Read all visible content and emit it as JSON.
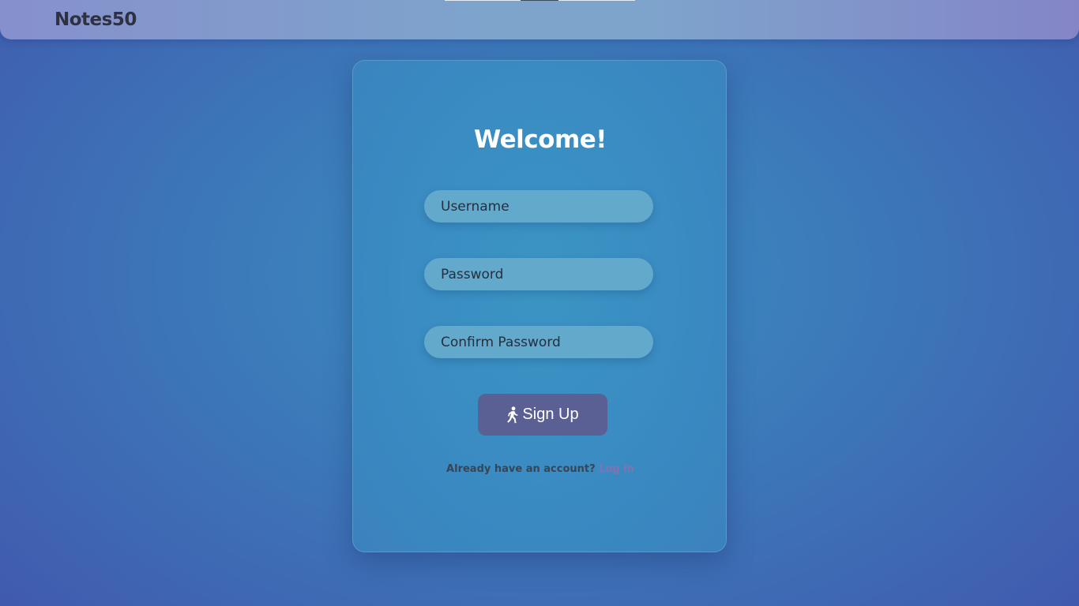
{
  "navbar": {
    "brand": "Notes50"
  },
  "form": {
    "title": "Welcome!",
    "username_placeholder": "Username",
    "password_placeholder": "Password",
    "confirm_password_placeholder": "Confirm Password",
    "submit_label": "Sign Up",
    "submit_icon": "walking-person-icon",
    "footer_text": "Already have an account?",
    "login_link_label": "Log in"
  },
  "colors": {
    "background_center": "#3a8fc0",
    "background_edge": "#4158ad",
    "card": "#3a8bc2",
    "input": "#62a9cc",
    "button": "#5a5f94",
    "link": "#8a6fb0"
  }
}
